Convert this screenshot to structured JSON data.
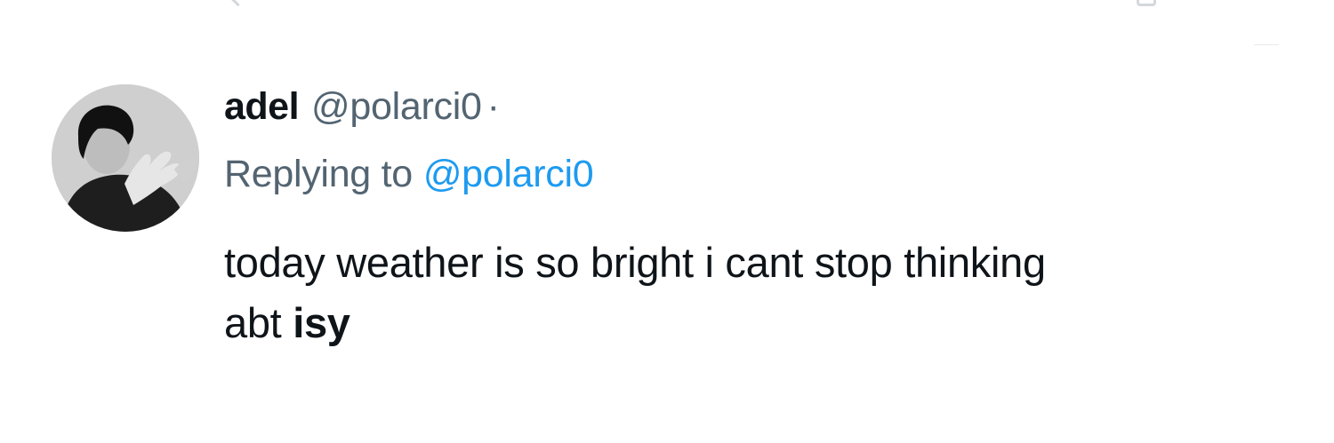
{
  "tweet": {
    "author": {
      "display_name": "adel",
      "handle": "@polarci0",
      "separator": "·",
      "avatar_icon": "avatar-photo"
    },
    "reply": {
      "prefix": "Replying to",
      "handle": "@polarci0"
    },
    "text": {
      "line1": "today weather is so bright i cant stop thinking",
      "line2_prefix": "abt ",
      "line2_bold": "isy"
    }
  },
  "colors": {
    "text_primary": "#0f1419",
    "text_secondary": "#536471",
    "link": "#1d9bf0",
    "background": "#ffffff"
  }
}
